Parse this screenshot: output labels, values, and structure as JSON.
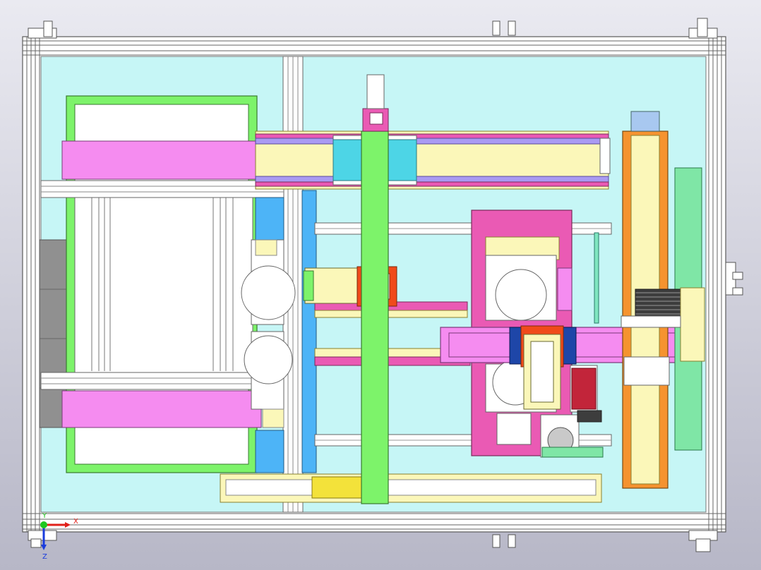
{
  "viewport": {
    "background_top": "#e9e9f0",
    "background_bottom": "#b9b9c8"
  },
  "colors": {
    "table_top": "#c6f6f6",
    "frame": "#ffffff",
    "frame_edge": "#6a6a6a",
    "green": "#7df36a",
    "magenta": "#f58cf0",
    "pink": "#ea5ab4",
    "blue": "#4db4f7",
    "orange": "#f5932f",
    "cream": "#fbf7b9",
    "red": "#f04a1a",
    "navy": "#1e46a8",
    "gray": "#8a8a8a",
    "dark_gray": "#3d3d3d",
    "violet": "#a99af2",
    "mint": "#7fe6a6",
    "yellow": "#f3e23a"
  },
  "triad": {
    "x_label": "X",
    "y_label": "Y",
    "z_label": "Z",
    "x_color": "#e0201a",
    "y_color": "#1ec81e",
    "z_color": "#1a3cdc"
  }
}
